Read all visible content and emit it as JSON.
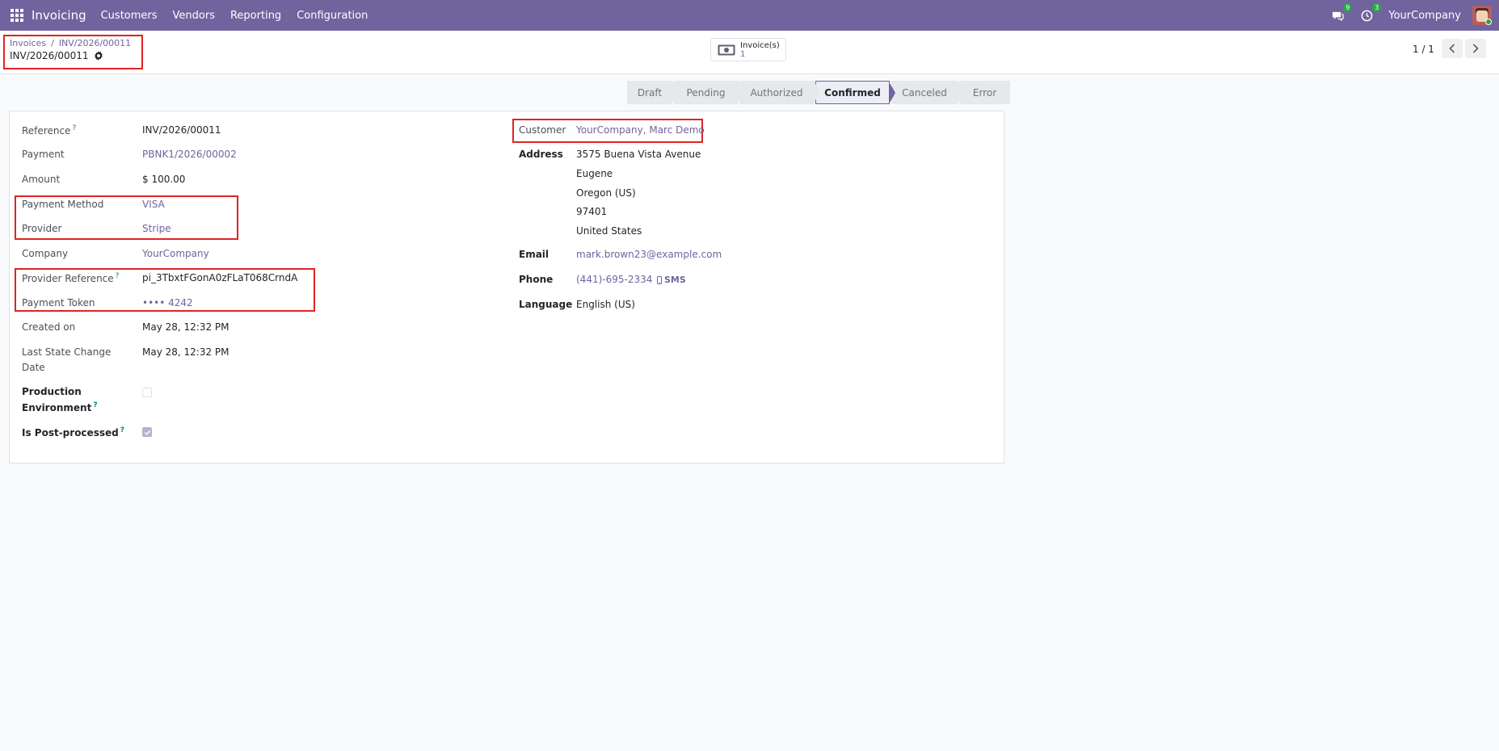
{
  "navbar": {
    "app_name": "Invoicing",
    "menu": [
      "Customers",
      "Vendors",
      "Reporting",
      "Configuration"
    ],
    "messages_count": "9",
    "activities_count": "3",
    "company": "YourCompany",
    "bg_color": "#71639e"
  },
  "control_panel": {
    "breadcrumb": [
      "Invoices",
      "INV/2026/00011"
    ],
    "breadcrumb_separator": "/",
    "record_title": "INV/2026/00011",
    "smart_button": {
      "label": "Invoice(s)",
      "value": "1",
      "icon": "money-icon"
    },
    "pager": "1 / 1"
  },
  "statusbar": {
    "stages": [
      "Draft",
      "Pending",
      "Authorized",
      "Confirmed",
      "Canceled",
      "Error"
    ],
    "active": "Confirmed"
  },
  "left_fields": {
    "reference": {
      "label": "Reference",
      "value": "INV/2026/00011",
      "help": "?"
    },
    "payment": {
      "label": "Payment",
      "value": "PBNK1/2026/00002"
    },
    "amount": {
      "label": "Amount",
      "value": "$ 100.00"
    },
    "payment_method": {
      "label": "Payment Method",
      "value": "VISA"
    },
    "provider": {
      "label": "Provider",
      "value": "Stripe"
    },
    "company": {
      "label": "Company",
      "value": "YourCompany"
    },
    "provider_reference": {
      "label": "Provider Reference",
      "value": "pi_3TbxtFGonA0zFLaT068CrndA",
      "help": "?"
    },
    "payment_token": {
      "label": "Payment Token",
      "value": "•••• 4242"
    },
    "created_on": {
      "label": "Created on",
      "value": "May 28, 12:32 PM"
    },
    "last_state_change_1": "Last State Change",
    "last_state_change_2": "Date",
    "last_state_change_value": "May 28, 12:32 PM",
    "production_env_1": "Production",
    "production_env_2": "Environment",
    "production_env_help": "?",
    "production_env_checked": false,
    "is_post_processed": {
      "label": "Is Post-processed",
      "help": "?",
      "checked": true
    }
  },
  "right_fields": {
    "customer": {
      "label": "Customer",
      "value": "YourCompany, Marc Demo"
    },
    "address": {
      "label": "Address",
      "lines": [
        "3575 Buena Vista Avenue",
        "Eugene",
        "Oregon (US)",
        "97401",
        "United States"
      ]
    },
    "email": {
      "label": "Email",
      "value": "mark.brown23@example.com"
    },
    "phone": {
      "label": "Phone",
      "value": "(441)-695-2334",
      "sms": "SMS"
    },
    "language": {
      "label": "Language",
      "value": "English (US)"
    }
  }
}
